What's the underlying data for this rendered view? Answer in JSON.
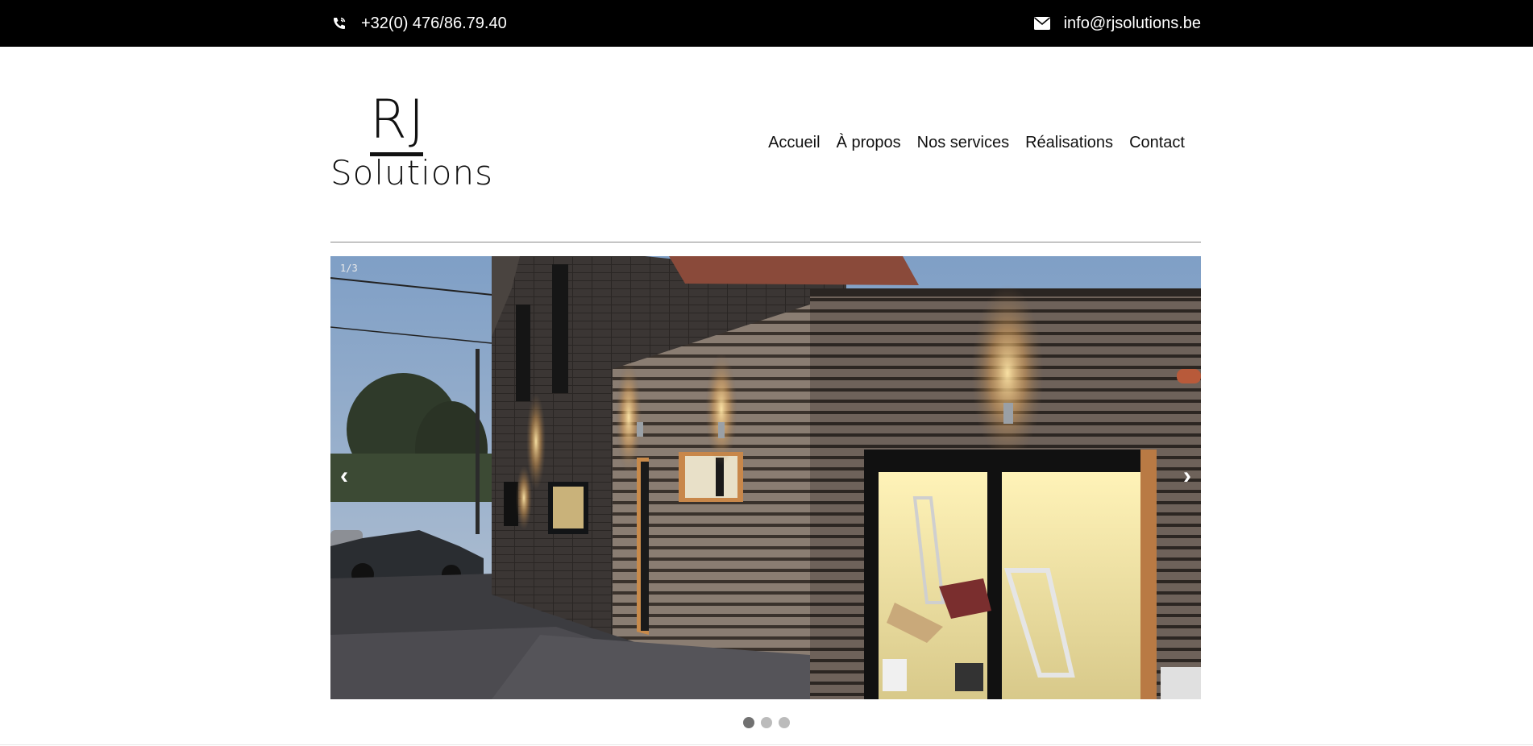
{
  "topbar": {
    "phone": "+32(0) 476/86.79.40",
    "phone_icon": "phone-icon",
    "email": "info@rjsolutions.be",
    "email_icon": "envelope-icon"
  },
  "logo": {
    "line1": "RJ",
    "line2": "Solutions"
  },
  "nav": {
    "items": [
      "Accueil",
      "À propos",
      "Nos services",
      "Réalisations",
      "Contact"
    ]
  },
  "slider": {
    "counter": "1/3",
    "prev_label": "‹",
    "next_label": "›",
    "slide_count": 3,
    "active_index": 0
  },
  "colors": {
    "topbar_bg": "#000000",
    "text": "#111111",
    "dot_active": "#717171",
    "dot_inactive": "#bbbbbb"
  }
}
